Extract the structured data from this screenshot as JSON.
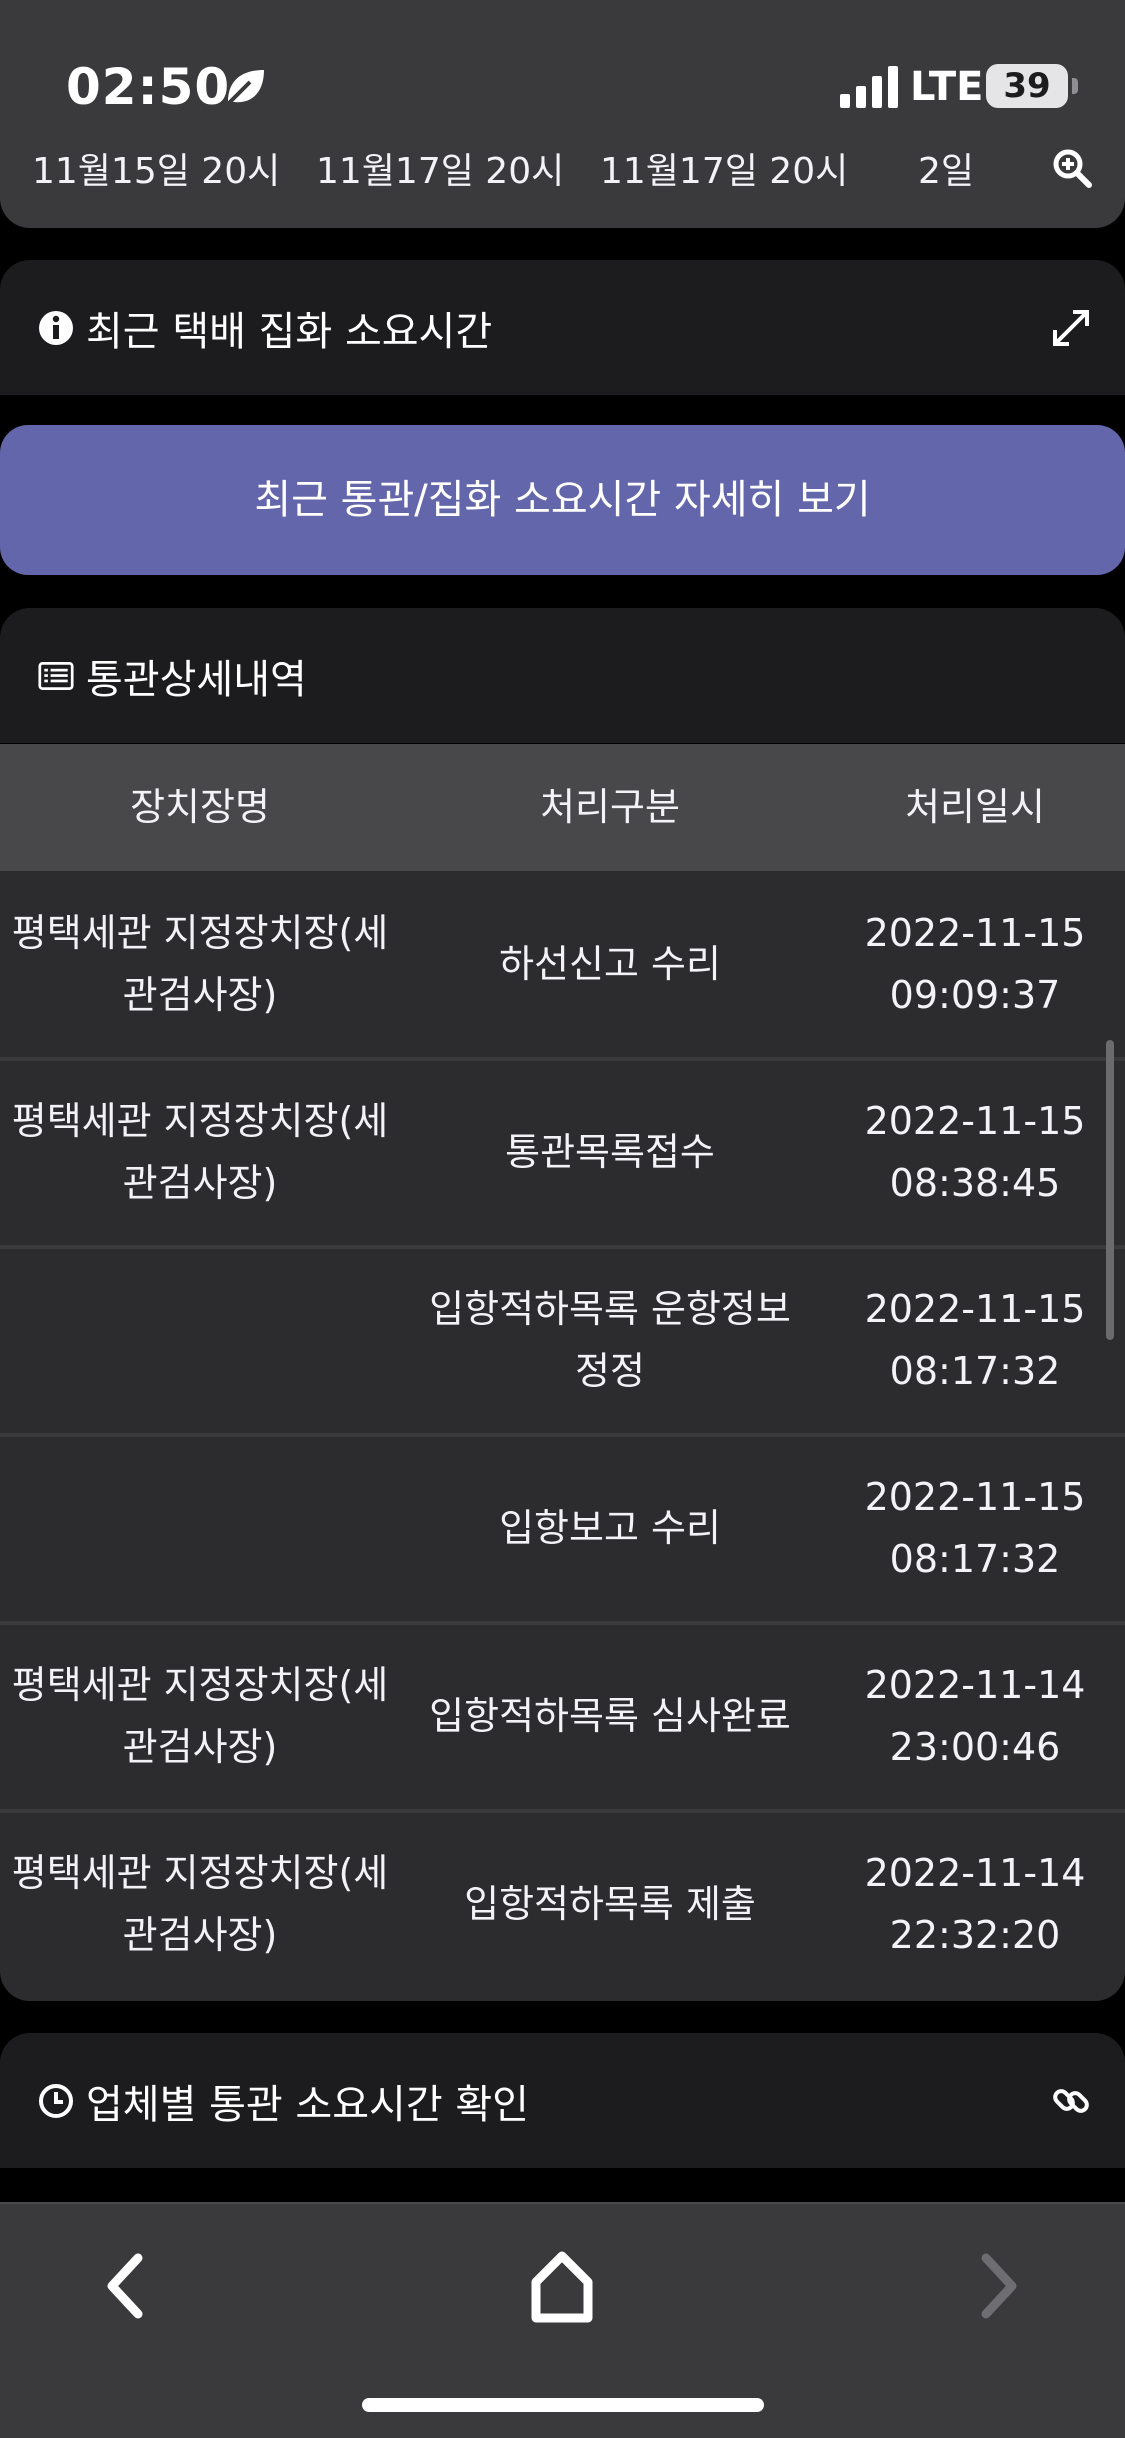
{
  "status_bar": {
    "time": "02:50",
    "network": "LTE",
    "battery": "39"
  },
  "top_card": {
    "cells": [
      "11월15일 20시",
      "11월17일 20시",
      "11월17일 20시",
      "2일"
    ]
  },
  "recent_parcel": {
    "title": "최근 택배 집화 소요시간"
  },
  "detail_button": {
    "label": "최근 통관/집화 소요시간 자세히 보기"
  },
  "customs_detail": {
    "title": "통관상세내역",
    "columns": [
      "장치장명",
      "처리구분",
      "처리일시"
    ],
    "rows": [
      {
        "place": [
          "평택세관 지정장치장(세",
          "관검사장)"
        ],
        "type": [
          "하선신고 수리"
        ],
        "datetime": [
          "2022-11-15",
          "09:09:37"
        ]
      },
      {
        "place": [
          "평택세관 지정장치장(세",
          "관검사장)"
        ],
        "type": [
          "통관목록접수"
        ],
        "datetime": [
          "2022-11-15",
          "08:38:45"
        ]
      },
      {
        "place": [
          "",
          ""
        ],
        "type": [
          "입항적하목록 운항정보",
          "정정"
        ],
        "datetime": [
          "2022-11-15",
          "08:17:32"
        ]
      },
      {
        "place": [
          "",
          ""
        ],
        "type": [
          "입항보고 수리"
        ],
        "datetime": [
          "2022-11-15",
          "08:17:32"
        ]
      },
      {
        "place": [
          "평택세관 지정장치장(세",
          "관검사장)"
        ],
        "type": [
          "입항적하목록 심사완료"
        ],
        "datetime": [
          "2022-11-14",
          "23:00:46"
        ]
      },
      {
        "place": [
          "평택세관 지정장치장(세",
          "관검사장)"
        ],
        "type": [
          "입항적하목록 제출"
        ],
        "datetime": [
          "2022-11-14",
          "22:32:20"
        ]
      }
    ]
  },
  "company_time": {
    "title": "업체별 통관 소요시간 확인"
  },
  "icons": {
    "leaf": "leaf-icon",
    "zoom": "zoom-in-icon",
    "info": "info-icon",
    "expand": "expand-icon",
    "list": "list-icon",
    "clock": "clock-icon",
    "link": "link-icon",
    "back": "back-arrow-icon",
    "home": "home-icon",
    "forward": "forward-arrow-icon"
  },
  "colors": {
    "accent": "#6366aa",
    "background": "#000000",
    "card": "#2c2c2e",
    "header": "#1c1c1e"
  }
}
